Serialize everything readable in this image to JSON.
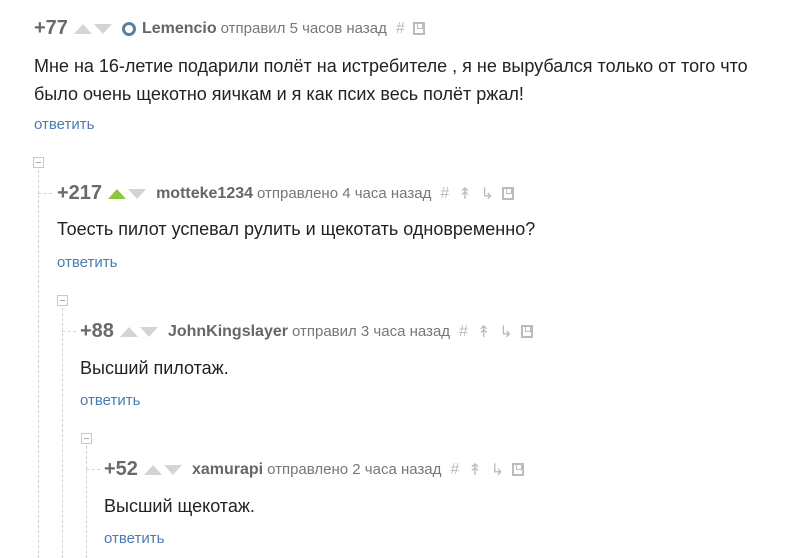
{
  "comments": [
    {
      "rating": "+77",
      "author": "Lemencio",
      "action": "отправил 5 часов назад",
      "lines": [
        "Мне на 16-летие подарили полёт на истребителе , я не вырубался только от того что",
        "было очень щекотно яичкам и я как псих весь полёт ржал!"
      ],
      "reply": "ответить"
    },
    {
      "rating": "+217",
      "author": "motteke1234",
      "action": "отправлено 4 часа назад",
      "lines": [
        "Тоесть пилот успевал рулить и щекотать одновременно?"
      ],
      "reply": "ответить"
    },
    {
      "rating": "+88",
      "author": "JohnKingslayer",
      "action": "отправил 3 часа назад",
      "lines": [
        "Высший пилотаж."
      ],
      "reply": "ответить"
    },
    {
      "rating": "+52",
      "author": "xamurapi",
      "action": "отправлено 2 часа назад",
      "lines": [
        "Высший щекотаж."
      ],
      "reply": "ответить"
    }
  ],
  "icons": {
    "hash": "#",
    "parent": "↟",
    "branch": "↳",
    "save": "save-icon"
  },
  "colors": {
    "upvote_active": "#8dc63f",
    "link": "#4a7bb1"
  }
}
